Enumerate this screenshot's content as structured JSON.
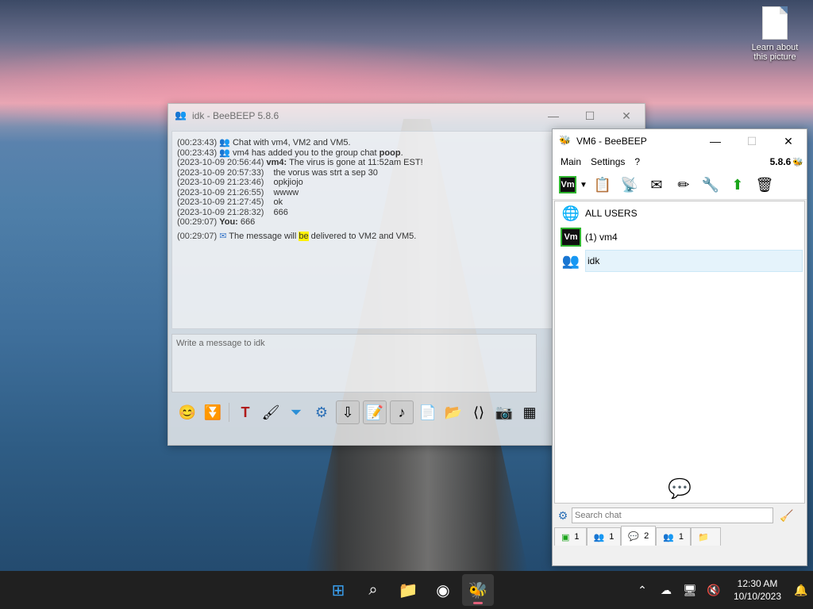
{
  "desktop": {
    "icon_label": "Learn about this picture"
  },
  "chat_window": {
    "title": "idk - BeeBEEP 5.8.6",
    "messages": [
      {
        "ts": "(00:23:43)",
        "pre": "",
        "text": "Chat with vm4, VM2 and VM5.",
        "icon": "group"
      },
      {
        "ts": "(00:23:43)",
        "pre": "",
        "text": "vm4 has added you to the group chat ",
        "bold": "poop",
        "post": ".",
        "icon": "group"
      },
      {
        "ts": "(2023-10-09 20:56:44)",
        "sender": "vm4:",
        "text": " The virus is gone at 11:52am EST!"
      },
      {
        "ts": "(2023-10-09 20:57:33)",
        "text": "the vorus was strt a sep 30"
      },
      {
        "ts": "(2023-10-09 21:23:46)",
        "text": "opkjiojo"
      },
      {
        "ts": "(2023-10-09 21:26:55)",
        "text": "wwww"
      },
      {
        "ts": "(2023-10-09 21:27:45)",
        "text": "ok"
      },
      {
        "ts": "(2023-10-09 21:28:32)",
        "text": "666"
      },
      {
        "ts": "(00:29:07)",
        "sender": "You:",
        "text": " 666"
      },
      {
        "ts": "(00:29:07)",
        "pre": "The message will ",
        "highlight": "be",
        "post": " delivered to VM2 and VM5.",
        "icon": "mail"
      }
    ],
    "compose_placeholder": "Write a message to idk"
  },
  "main_window": {
    "title": "VM6 - BeeBEEP",
    "menu": [
      "Main",
      "Settings",
      "?"
    ],
    "version": "5.8.6",
    "vm_badge": "Vm",
    "users": [
      {
        "label": "ALL USERS",
        "icon": "globe"
      },
      {
        "label": "(1) vm4",
        "icon": "vm"
      },
      {
        "label": "idk",
        "icon": "group"
      }
    ],
    "search_placeholder": "Search chat",
    "tabs": [
      {
        "count": "1",
        "icon": "screen"
      },
      {
        "count": "1",
        "icon": "users"
      },
      {
        "count": "2",
        "icon": "chat"
      },
      {
        "count": "1",
        "icon": "group"
      },
      {
        "count": "",
        "icon": "file"
      }
    ]
  },
  "taskbar": {
    "time": "12:30 AM",
    "date": "10/10/2023"
  },
  "colors": {
    "highlight": "#fff200",
    "vm_badge_border": "#2fb52f",
    "taskbar": "#202020"
  }
}
